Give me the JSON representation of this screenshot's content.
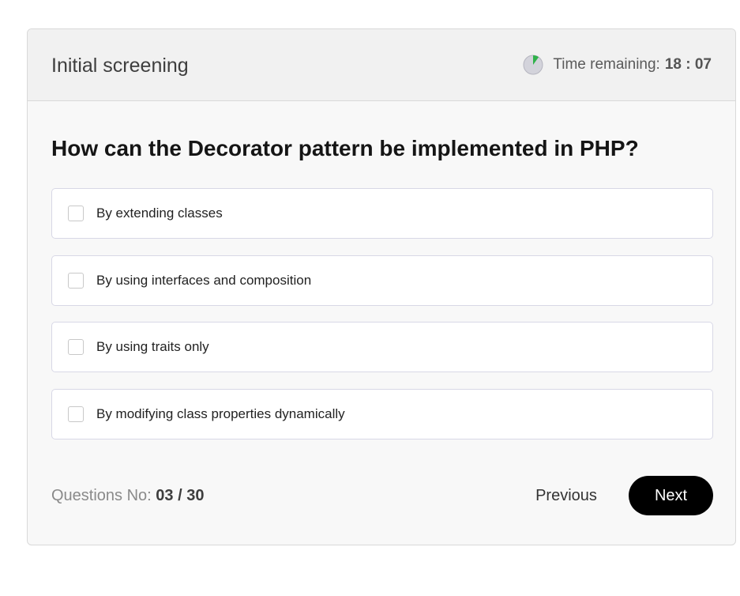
{
  "header": {
    "title": "Initial screening",
    "timer_label": "Time remaining:",
    "timer_value": "18 : 07",
    "timer_icon": "pie-timer-icon",
    "timer_progress": 0.1
  },
  "question": {
    "text": "How can the Decorator pattern be implemented in PHP?",
    "options": [
      {
        "label": "By extending classes",
        "checked": false
      },
      {
        "label": "By using interfaces and composition",
        "checked": false
      },
      {
        "label": "By using traits only",
        "checked": false
      },
      {
        "label": "By modifying class properties dynamically",
        "checked": false
      }
    ]
  },
  "footer": {
    "question_no_label": "Questions No:",
    "question_count": "03 / 30",
    "previous_label": "Previous",
    "next_label": "Next"
  },
  "colors": {
    "timer_pie_bg": "#d3d3db",
    "timer_pie_fill": "#2fb24a",
    "next_bg": "#000000"
  }
}
